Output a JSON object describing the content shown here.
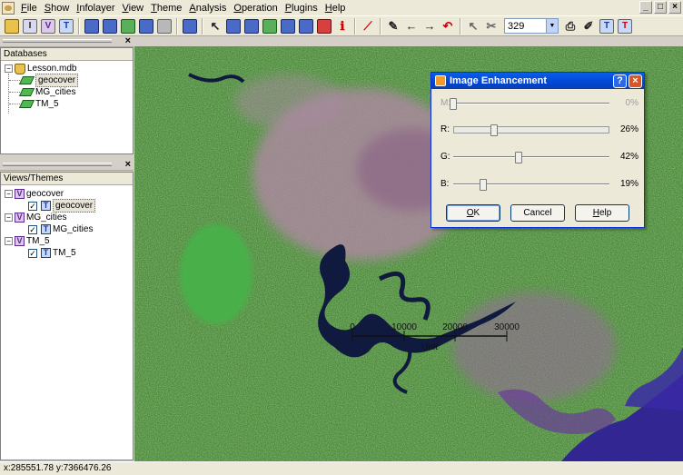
{
  "menu": [
    "File",
    "Show",
    "Infolayer",
    "View",
    "Theme",
    "Analysis",
    "Operation",
    "Plugins",
    "Help"
  ],
  "window_controls": [
    "_",
    "□",
    "×"
  ],
  "toolbar": {
    "zoom_value": "329",
    "icons": [
      "database-icon",
      "infolayer-icon",
      "view-icon",
      "theme-icon",
      "import-icon",
      "export-icon",
      "save-icon",
      "map-icon",
      "table-icon",
      "grid-icon",
      "pointer-icon",
      "zoom-in-icon",
      "zoom-out-icon",
      "zoom-area-icon",
      "pan-icon",
      "fit-icon",
      "hand-icon",
      "info-icon",
      "edit-line-icon",
      "pen-icon",
      "back-arrow-icon",
      "forward-arrow-icon",
      "undo-icon",
      "select-arrow-icon",
      "cut-icon",
      "print-icon",
      "draw-icon",
      "text-icon",
      "text-style-icon"
    ]
  },
  "databases_panel": {
    "title": "Databases",
    "root": "Lesson.mdb",
    "layers": [
      "geocover",
      "MG_cities",
      "TM_5"
    ]
  },
  "views_panel": {
    "title": "Views/Themes",
    "views": [
      {
        "view": "geocover",
        "theme": "geocover"
      },
      {
        "view": "MG_cities",
        "theme": "MG_cities"
      },
      {
        "view": "TM_5",
        "theme": "TM_5"
      }
    ]
  },
  "map": {
    "scalebar_labels": [
      "0",
      "10000",
      "20000",
      "30000"
    ],
    "scalebar_unit": "Unit"
  },
  "dialog": {
    "title": "Image Enhancement",
    "sliders": [
      {
        "label": "M:",
        "value": 0,
        "text": "0%",
        "enabled": false
      },
      {
        "label": "R:",
        "value": 26,
        "text": "26%",
        "enabled": true
      },
      {
        "label": "G:",
        "value": 42,
        "text": "42%",
        "enabled": true
      },
      {
        "label": "B:",
        "value": 19,
        "text": "19%",
        "enabled": true
      }
    ],
    "buttons": {
      "ok": "OK",
      "cancel": "Cancel",
      "help": "Help"
    }
  },
  "status": {
    "coords": "x:285551.78 y:7366476.26"
  },
  "colors": {
    "title_bar": "#0054e3",
    "water": "#101a3e",
    "urban": "#b487a8",
    "vegetation": "#3f8f34",
    "ocean": "#2e1a9a"
  }
}
